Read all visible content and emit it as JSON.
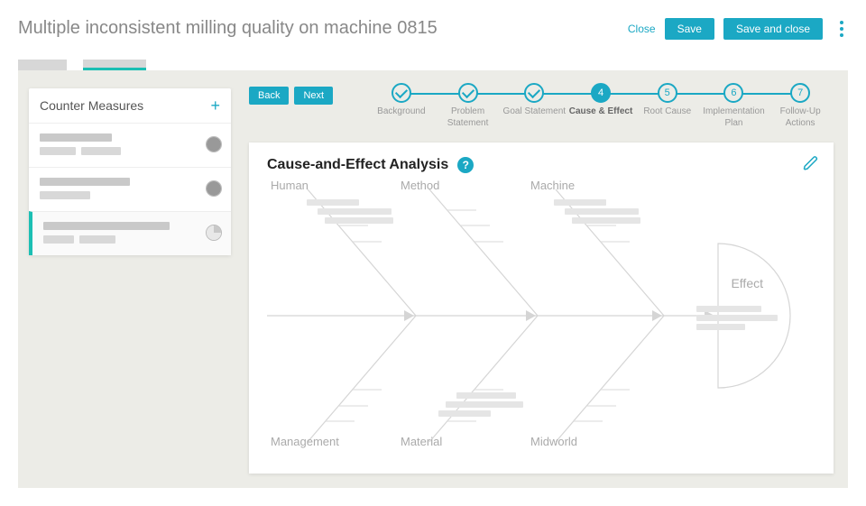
{
  "header": {
    "title": "Multiple inconsistent milling quality on machine 0815",
    "close_label": "Close",
    "save_label": "Save",
    "save_close_label": "Save and close"
  },
  "sidebar": {
    "title": "Counter Measures",
    "add_label": "+"
  },
  "nav": {
    "back_label": "Back",
    "next_label": "Next"
  },
  "stepper": {
    "items": [
      {
        "label": "Background",
        "state": "done"
      },
      {
        "label": "Problem Statement",
        "state": "done"
      },
      {
        "label": "Goal Statement",
        "state": "done"
      },
      {
        "label": "Cause & Effect",
        "state": "active",
        "num": "4"
      },
      {
        "label": "Root Cause",
        "state": "todo",
        "num": "5"
      },
      {
        "label": "Implementation Plan",
        "state": "todo",
        "num": "6"
      },
      {
        "label": "Follow-Up Actions",
        "state": "todo",
        "num": "7"
      }
    ]
  },
  "card": {
    "title": "Cause-and-Effect Analysis",
    "help_glyph": "?",
    "categories_top": [
      "Human",
      "Method",
      "Machine"
    ],
    "categories_bottom": [
      "Management",
      "Material",
      "Midworld"
    ],
    "effect_label": "Effect"
  },
  "colors": {
    "accent_blue": "#1ba8c4",
    "accent_teal": "#1bbfb3"
  }
}
